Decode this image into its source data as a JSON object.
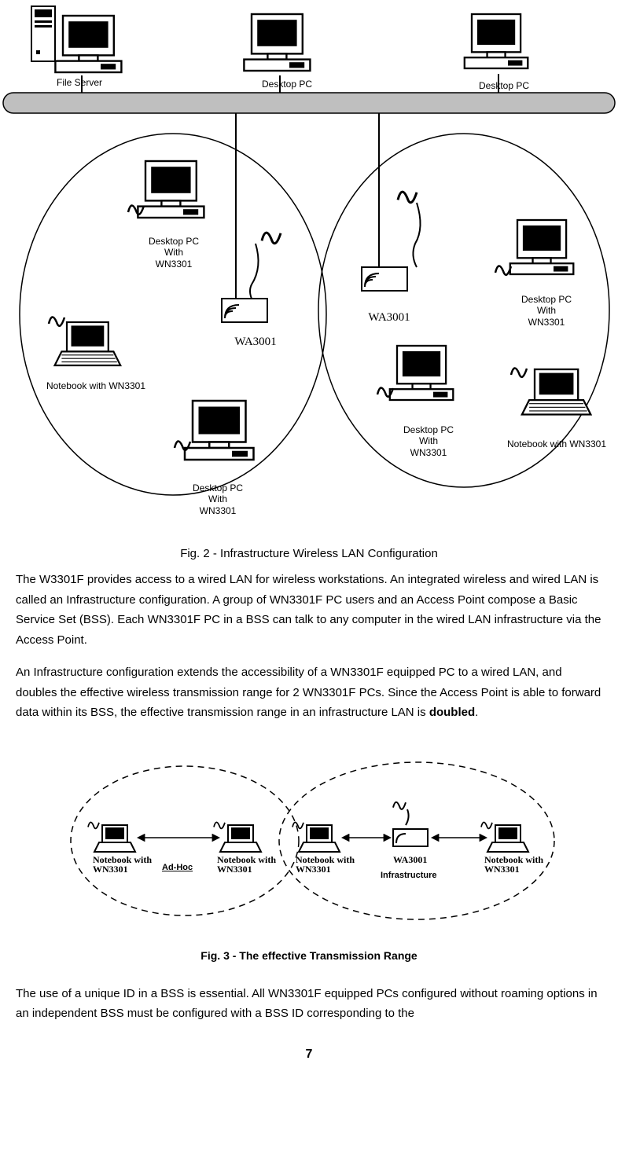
{
  "fig2": {
    "top": {
      "file_server": "File Server",
      "desktop_pc1": "Desktop PC",
      "desktop_pc2": "Desktop PC"
    },
    "left_cell": {
      "desktop1_l1": "Desktop PC",
      "desktop1_l2": "With",
      "desktop1_l3": "WN3301",
      "ap": "WA3001",
      "notebook": "Notebook with WN3301",
      "desktop2_l1": "Desktop PC",
      "desktop2_l2": "With",
      "desktop2_l3": "WN3301"
    },
    "right_cell": {
      "ap": "WA3001",
      "desktop1_l1": "Desktop PC",
      "desktop1_l2": "With",
      "desktop1_l3": "WN3301",
      "desktop2_l1": "Desktop PC",
      "desktop2_l2": "With",
      "desktop2_l3": "WN3301",
      "notebook": "Notebook with WN3301"
    },
    "caption": "Fig. 2 - Infrastructure Wireless LAN Configuration"
  },
  "para1": "The W3301F provides access to a wired LAN for wireless workstations. An integrated wireless and wired LAN is called an Infrastructure configuration. A group of WN3301F PC users and an Access Point compose a Basic Service Set (BSS). Each WN3301F PC in a BSS can talk to any computer in the wired LAN infrastructure via the Access Point.",
  "para2_pre": "An Infrastructure configuration extends the accessibility of a WN3301F equipped PC to a wired LAN, and doubles the effective wireless transmission range for 2 WN3301F PCs. Since the Access Point is able to forward data within its BSS, the effective transmission range in an infrastructure LAN is ",
  "para2_bold": "doubled",
  "para2_post": ".",
  "fig3": {
    "nb1_l1": "Notebook with",
    "nb1_l2": "WN3301",
    "adhoc": "Ad-Hoc",
    "nb2_l1": "Notebook with",
    "nb2_l2": "WN3301",
    "nb3_l1": "Notebook with",
    "nb3_l2": "WN3301",
    "ap": "WA3001",
    "infra": "Infrastructure",
    "nb4_l1": "Notebook with",
    "nb4_l2": "WN3301",
    "caption": "Fig. 3 - The effective Transmission Range"
  },
  "para3": "The use of a unique ID in a BSS is essential. All WN3301F equipped PCs configured without roaming options in an independent BSS must be configured with a BSS ID corresponding to the",
  "page_number": "7"
}
